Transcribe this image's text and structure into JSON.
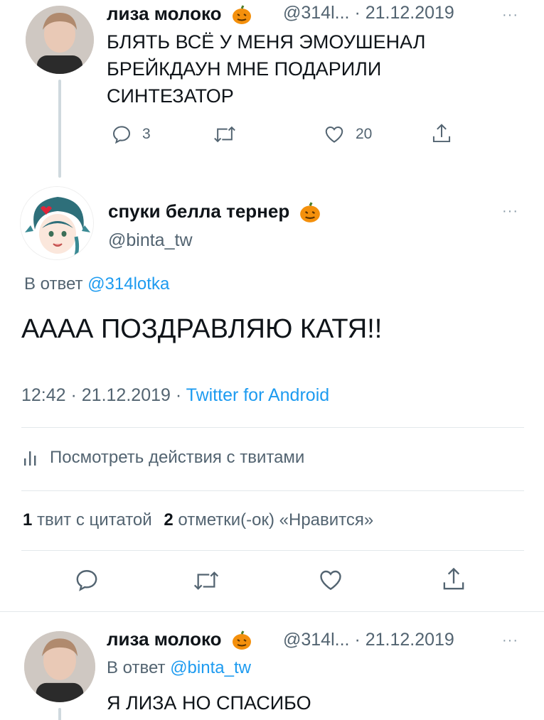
{
  "tweet1": {
    "name": "лиза молоко",
    "handle": "@314l...",
    "date": "· 21.12.2019",
    "line1": "БЛЯТЬ ВСЁ У МЕНЯ ЭМОУШЕНАЛ",
    "line2": "БРЕЙКДАУН МНЕ ПОДАРИЛИ",
    "line3": "СИНТЕЗАТОР",
    "replies": "3",
    "likes": "20"
  },
  "main_tweet": {
    "name": "спуки белла тернер",
    "handle": "@binta_tw",
    "reply_prefix": "В ответ",
    "reply_to": "@314lotka",
    "text": "АААА ПОЗДРАВЛЯЮ КАТЯ!!",
    "time_date": "12:42 · 21.12.2019 ·",
    "source": "Twitter for Android",
    "activity": "Посмотреть действия с твитами",
    "quotes_count": "1",
    "quotes_label": "твит с цитатой",
    "likes_count": "2",
    "likes_label": "отметки(-ок) «Нравится»"
  },
  "tweet3": {
    "name": "лиза молоко",
    "handle": "@314l...",
    "date": "· 21.12.2019",
    "reply_prefix": "В ответ",
    "reply_to": "@binta_tw",
    "text": "Я ЛИЗА НО СПАСИБО"
  },
  "more_glyph": "···",
  "icons": [
    "reply-icon",
    "retweet-icon",
    "like-icon",
    "share-icon",
    "activity-icon",
    "pumpkin-icon"
  ],
  "colors": {
    "link": "#1d9bf0",
    "secondary": "#536471",
    "divider": "#e3e8eb",
    "pumpkin": "#f4900c"
  }
}
